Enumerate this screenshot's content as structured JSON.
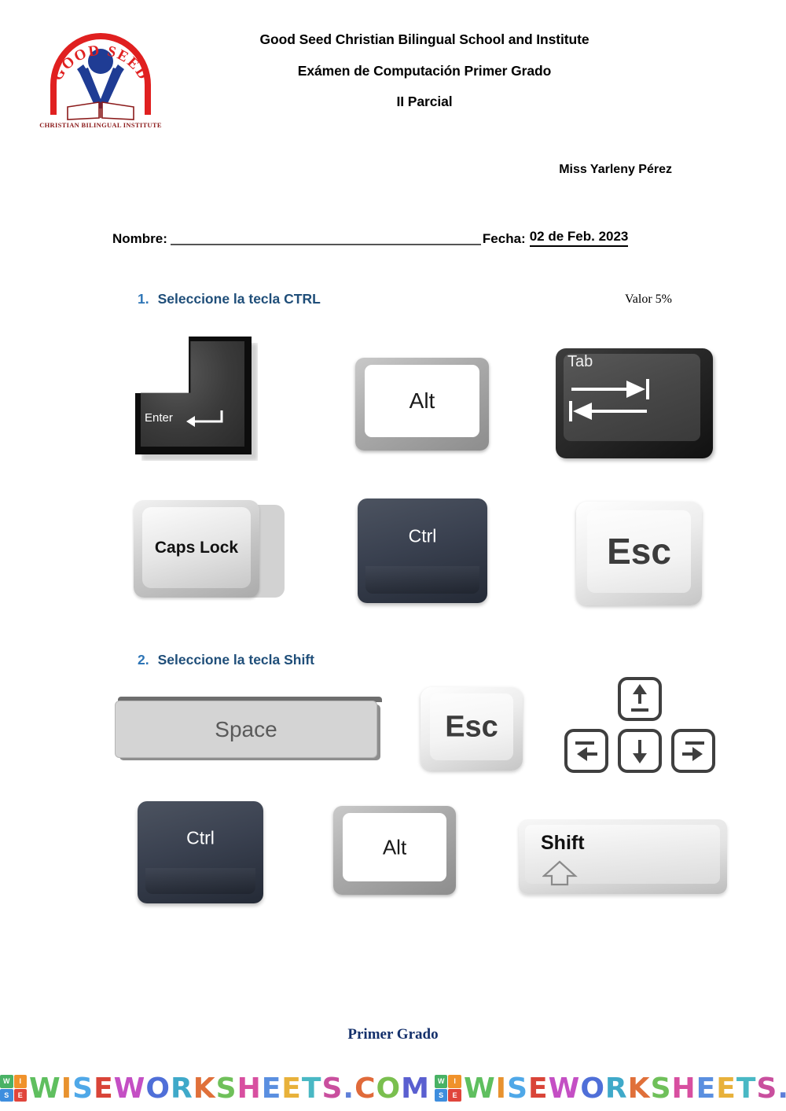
{
  "header": {
    "logo": {
      "top_text": "GOOD SEED",
      "bottom_text": "CHRISTIAN BILINGUAL INSTITUTE",
      "ring_color": "#E02020",
      "figure_color": "#1F3C94"
    },
    "title_lines": [
      "Good Seed Christian Bilingual School and Institute",
      "Exámen de Computación Primer Grado",
      "II Parcial"
    ],
    "teacher": "Miss Yarleny Pérez"
  },
  "form": {
    "name_label": "Nombre:",
    "name_value": "",
    "date_label": "Fecha:",
    "date_value": "02 de Feb. 2023"
  },
  "questions": [
    {
      "number": "1.",
      "text": "Seleccione la tecla CTRL",
      "valor": "Valor 5%",
      "options": [
        {
          "key": "Enter",
          "label": "Enter",
          "style": "enter-iso-dark"
        },
        {
          "key": "Alt",
          "label": "Alt",
          "style": "white-bezel"
        },
        {
          "key": "Tab",
          "label": "Tab",
          "style": "dark-tab"
        },
        {
          "key": "CapsLock",
          "label": "Caps Lock",
          "style": "light-stacked"
        },
        {
          "key": "Ctrl",
          "label": "Ctrl",
          "style": "dark-navy"
        },
        {
          "key": "Esc",
          "label": "Esc",
          "style": "white-esc"
        }
      ]
    },
    {
      "number": "2.",
      "text": "Seleccione la tecla Shift",
      "valor": "",
      "options": [
        {
          "key": "Space",
          "label": "Space",
          "style": "spacebar"
        },
        {
          "key": "Esc",
          "label": "Esc",
          "style": "white-esc"
        },
        {
          "key": "Arrows",
          "label": "",
          "style": "arrow-cluster"
        },
        {
          "key": "Ctrl",
          "label": "Ctrl",
          "style": "dark-navy"
        },
        {
          "key": "Alt",
          "label": "Alt",
          "style": "white-bezel"
        },
        {
          "key": "Shift",
          "label": "Shift",
          "style": "light-shift"
        }
      ]
    }
  ],
  "footer": {
    "grade": "Primer Grado",
    "watermark_text": "WISEWORKSHEETS.COM",
    "watermark_logo_letters": [
      "W",
      "I",
      "S",
      "E"
    ],
    "watermark_logo_colors": [
      "#49B265",
      "#F0922B",
      "#3E8EDE",
      "#E0453C"
    ]
  },
  "colors": {
    "question_number": "#2E75B6",
    "question_text": "#1F4E79",
    "footer_grade": "#14306B"
  }
}
